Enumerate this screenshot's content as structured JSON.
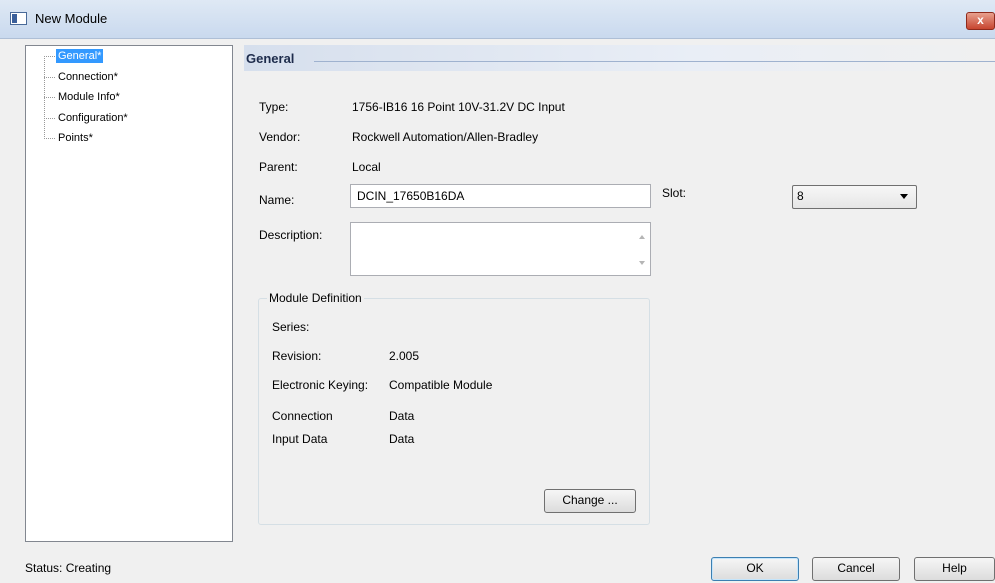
{
  "window": {
    "title": "New Module",
    "close_label": "x"
  },
  "tree": {
    "items": [
      {
        "label": "General*"
      },
      {
        "label": "Connection*"
      },
      {
        "label": "Module Info*"
      },
      {
        "label": "Configuration*"
      },
      {
        "label": "Points*"
      }
    ],
    "selected": "General*"
  },
  "section": {
    "title": "General"
  },
  "general": {
    "type_label": "Type:",
    "type_value": "1756-IB16 16 Point 10V-31.2V DC Input",
    "vendor_label": "Vendor:",
    "vendor_value": "Rockwell Automation/Allen-Bradley",
    "parent_label": "Parent:",
    "parent_value": "Local",
    "name_label": "Name:",
    "name_value": "DCIN_17650B16DA",
    "slot_label": "Slot:",
    "slot_value": "8",
    "description_label": "Description:",
    "description_value": ""
  },
  "module_definition": {
    "legend": "Module Definition",
    "series_label": "Series:",
    "series_value": "",
    "revision_label": "Revision:",
    "revision_value": "2.005",
    "keying_label": "Electronic Keying:",
    "keying_value": "Compatible Module",
    "connection_label": "Connection",
    "connection_value": "Data",
    "input_label": "Input Data",
    "input_value": "Data",
    "change_label": "Change ..."
  },
  "footer": {
    "status": "Status:  Creating",
    "ok_label": "OK",
    "cancel_label": "Cancel",
    "help_label": "Help"
  }
}
